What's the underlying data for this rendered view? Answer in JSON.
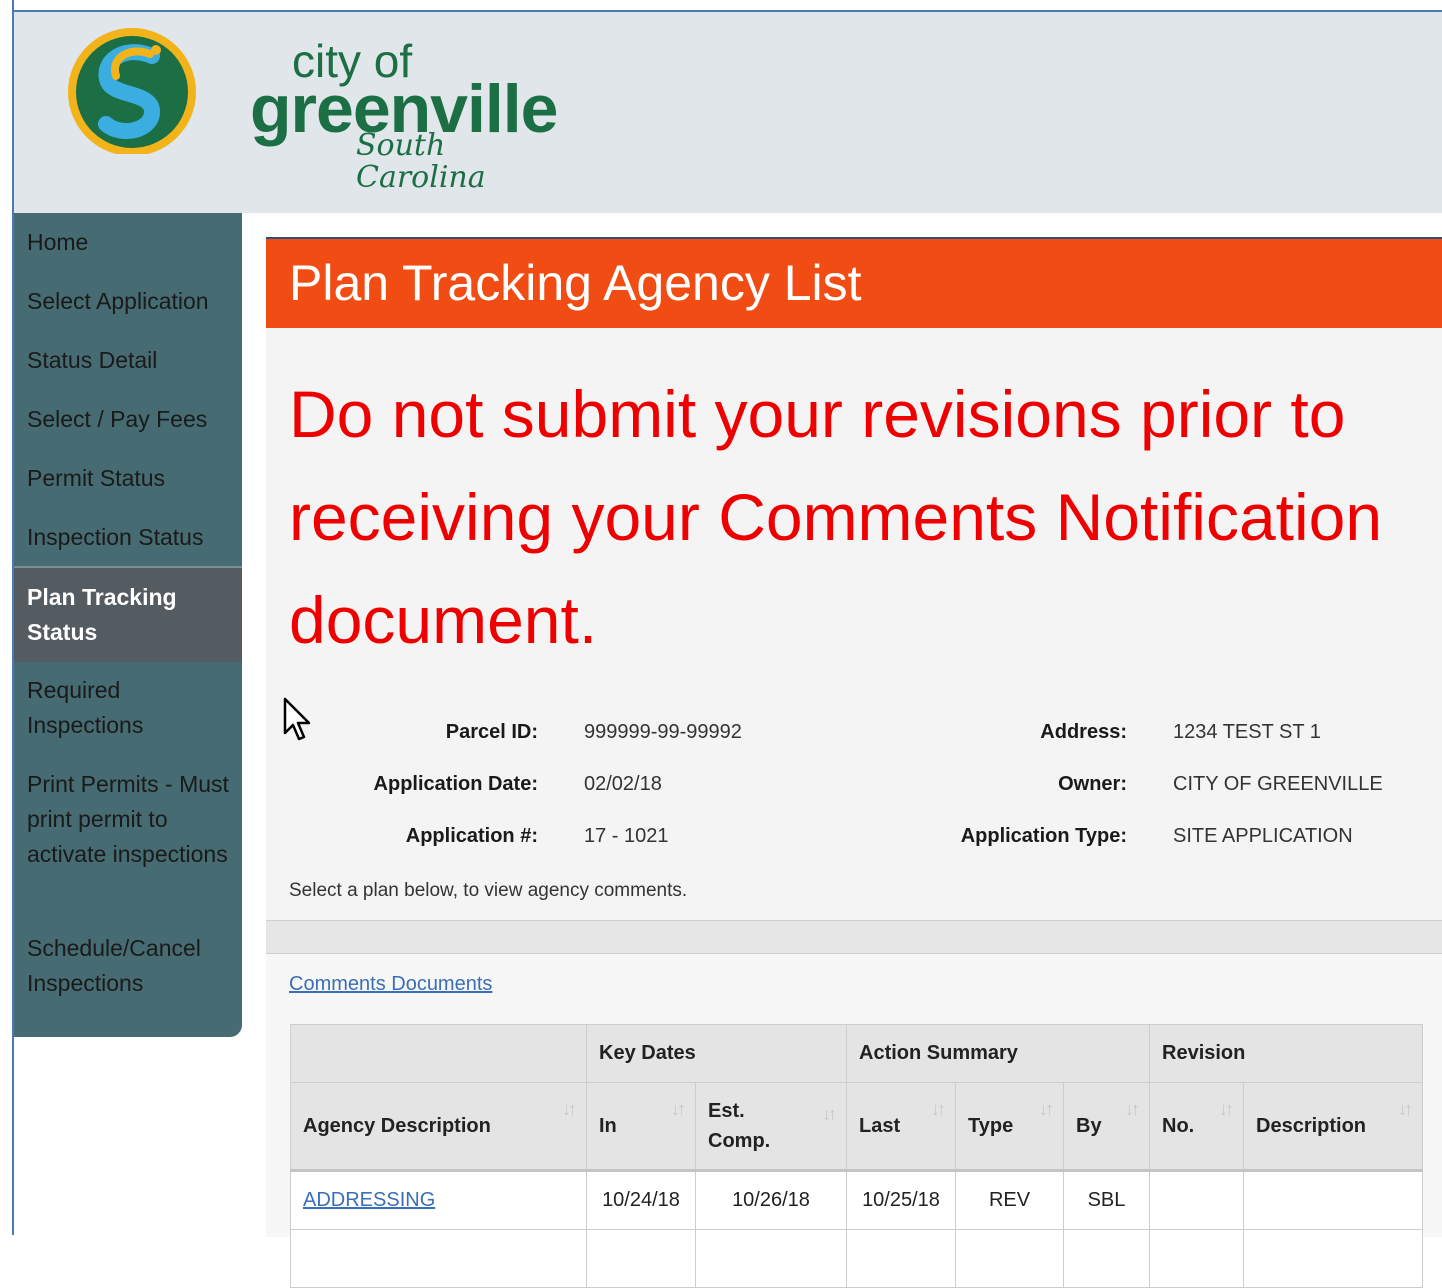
{
  "header": {
    "logo_text_top": "city of",
    "logo_text_main": "greenville",
    "logo_text_sub": "South Carolina",
    "brand_green": "#1c6e45",
    "brand_blue": "#3aaee0",
    "brand_yellow": "#f2b31b"
  },
  "sidebar": {
    "items": [
      {
        "label": "Home"
      },
      {
        "label": "Select Application"
      },
      {
        "label": "Status Detail"
      },
      {
        "label": "Select / Pay Fees"
      },
      {
        "label": "Permit Status"
      },
      {
        "label": "Inspection Status"
      },
      {
        "label": "Plan Tracking Status",
        "active": true
      },
      {
        "label": "Required Inspections"
      },
      {
        "label": "Print Permits - Must print permit to activate inspections"
      },
      {
        "label": "Schedule/Cancel Inspections"
      }
    ]
  },
  "main": {
    "title": "Plan Tracking Agency List",
    "warning": "Do not submit your revisions prior to receiving your Comments Notification document.",
    "info": {
      "parcel_id_label": "Parcel ID:",
      "parcel_id": "999999-99-99992",
      "application_date_label": "Application Date:",
      "application_date": "02/02/18",
      "application_no_label": "Application #:",
      "application_no": "17 - 1021",
      "address_label": "Address:",
      "address": "1234 TEST ST 1",
      "owner_label": "Owner:",
      "owner": "CITY OF GREENVILLE",
      "application_type_label": "Application Type:",
      "application_type": "SITE APPLICATION"
    },
    "hint": "Select a plan below, to view agency comments.",
    "comments_documents_link": "Comments Documents",
    "accent_color": "#f04c14",
    "warning_color": "#ee0000"
  },
  "table": {
    "groups": {
      "key_dates": "Key Dates",
      "action_summary": "Action Summary",
      "revision": "Revision"
    },
    "columns": {
      "agency_description": "Agency Description",
      "in": "In",
      "est_comp": "Est. Comp.",
      "last": "Last",
      "type": "Type",
      "by": "By",
      "no": "No.",
      "description": "Description"
    },
    "rows": [
      {
        "agency": "ADDRESSING",
        "in": "10/24/18",
        "est_comp": "10/26/18",
        "last": "10/25/18",
        "type": "REV",
        "by": "SBL",
        "no": "",
        "description": ""
      }
    ]
  }
}
